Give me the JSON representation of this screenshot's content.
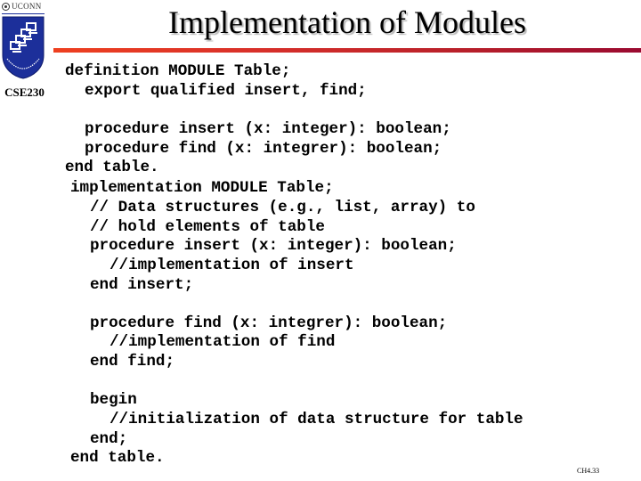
{
  "logo": {
    "wordmark": "UCONN",
    "course": "CSE230"
  },
  "slide": {
    "title": "Implementation of Modules",
    "page_number": "CH4.33"
  },
  "code": {
    "definition_block": [
      "definition MODULE Table;",
      "export qualified insert, find;",
      "procedure insert (x: integer): boolean;",
      "procedure find (x: integrer): boolean;",
      "end table."
    ],
    "implementation_block": [
      "implementation MODULE Table;",
      "// Data structures (e.g., list, array) to",
      "// hold elements of table",
      "procedure insert (x: integer): boolean;",
      "//implementation of insert",
      "end insert;",
      "procedure find (x: integrer): boolean;",
      "//implementation of find",
      "end find;",
      "begin",
      "//initialization of data structure for table",
      "end;",
      "end table."
    ]
  },
  "colors": {
    "rule_start": "#ee4020",
    "rule_end": "#9a0a30",
    "shield": "#1c2f9a"
  }
}
